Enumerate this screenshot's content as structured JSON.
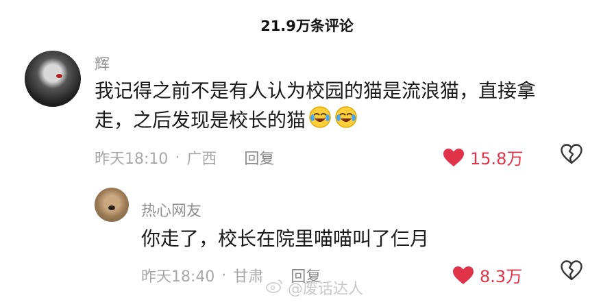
{
  "header": {
    "title": "21.9万条评论"
  },
  "comments": [
    {
      "username": "辉",
      "text_line1": "我记得之前不是有人认为校园的猫是流浪猫，直接拿",
      "text_line2": "走，之后发现是校长的猫",
      "emojis": [
        "laugh-cry-emoji",
        "laugh-cry-emoji"
      ],
      "time": "昨天18:10",
      "separator": "·",
      "location": "广西",
      "reply_label": "回复",
      "likes": "15.8万"
    },
    {
      "username": "热心网友",
      "text": "你走了，校长在院里喵喵叫了仨月",
      "time": "昨天18:40",
      "separator": "·",
      "location": "甘肃",
      "reply_label": "回复",
      "likes": "8.3万"
    }
  ],
  "watermark": {
    "text": "@废话达人"
  },
  "colors": {
    "like": "#e0334a",
    "muted": "#a8a8a8",
    "text": "#1a1a1a"
  },
  "icons": [
    "heart-icon",
    "broken-heart-icon",
    "weibo-icon"
  ]
}
